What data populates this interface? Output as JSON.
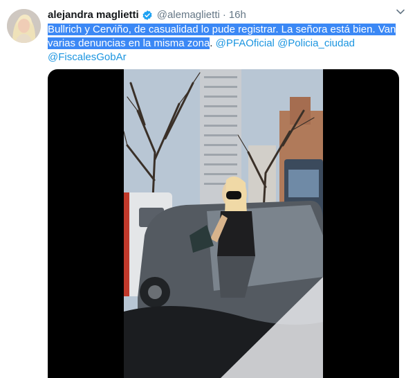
{
  "tweet": {
    "author_name": "alejandra maglietti",
    "handle": "@alemaglietti",
    "separator": "·",
    "time": "16h",
    "text_highlighted_line1": "Bullrich y Cerviño, de casualidad lo pude registrar. La señora está bien. Van",
    "text_highlighted_line2": "varias denuncias en la misma zona",
    "text_after": ". ",
    "mentions": [
      "@PFAOficial",
      "@Policia_ciudad",
      "@FiscalesGobAr"
    ],
    "icons": {
      "verified": "verified-badge-icon",
      "menu": "chevron-down-icon"
    },
    "colors": {
      "verified": "#1da1f2",
      "mention": "#1b95e0",
      "highlight": "#3b88f5",
      "muted": "#657786"
    }
  }
}
